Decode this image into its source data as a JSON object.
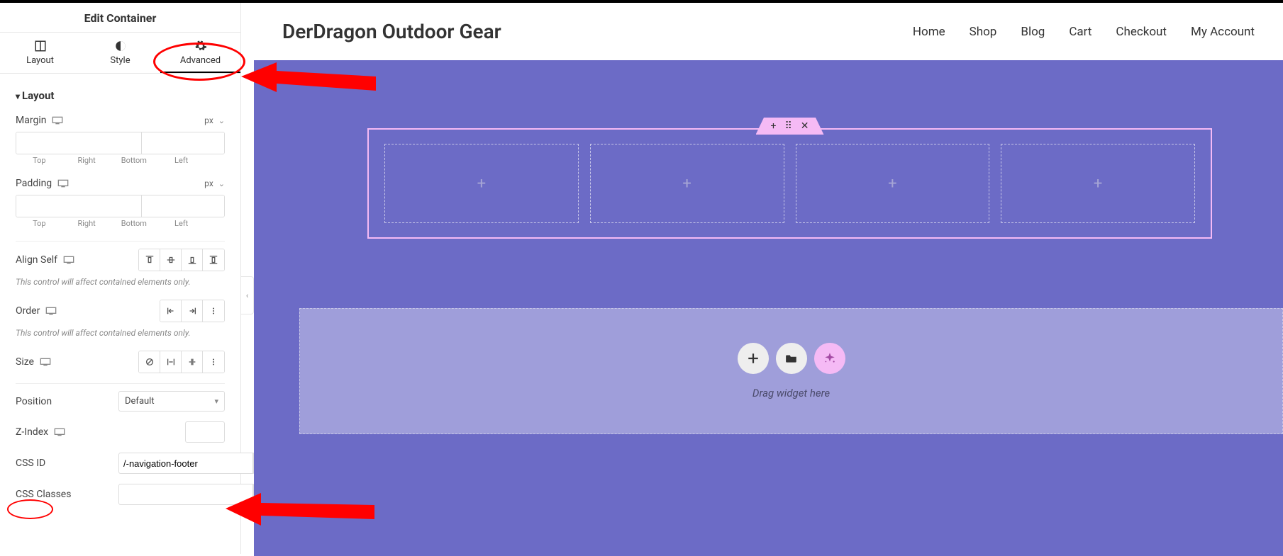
{
  "panel": {
    "title": "Edit Container",
    "tabs": {
      "layout": "Layout",
      "style": "Style",
      "advanced": "Advanced"
    },
    "section_layout": "Layout",
    "margin": {
      "label": "Margin",
      "unit": "px",
      "top": "Top",
      "right": "Right",
      "bottom": "Bottom",
      "left": "Left"
    },
    "padding": {
      "label": "Padding",
      "unit": "px",
      "top": "Top",
      "right": "Right",
      "bottom": "Bottom",
      "left": "Left"
    },
    "align_self": {
      "label": "Align Self"
    },
    "note": "This control will affect contained elements only.",
    "order": {
      "label": "Order"
    },
    "size": {
      "label": "Size"
    },
    "position": {
      "label": "Position",
      "value": "Default"
    },
    "zindex": {
      "label": "Z-Index"
    },
    "css_id": {
      "label": "CSS ID",
      "value": "/-navigation-footer"
    },
    "css_classes": {
      "label": "CSS Classes",
      "value": ""
    }
  },
  "site": {
    "title": "DerDragon Outdoor Gear",
    "nav": [
      "Home",
      "Shop",
      "Blog",
      "Cart",
      "Checkout",
      "My Account"
    ]
  },
  "canvas": {
    "drop_text": "Drag widget here"
  }
}
